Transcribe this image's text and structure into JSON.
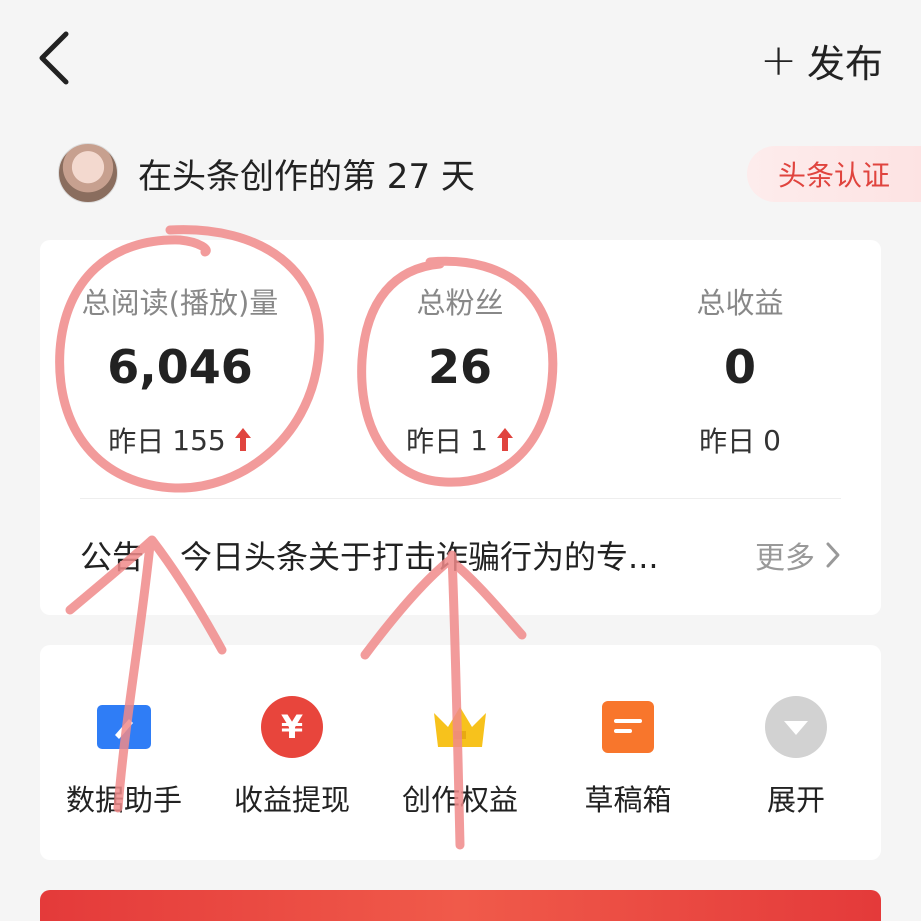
{
  "header": {
    "back_icon": "chevron-left-icon",
    "publish_plus": "+",
    "publish_label": "发布"
  },
  "creator": {
    "days_text": "在头条创作的第 27 天",
    "certification_label": "头条认证"
  },
  "stats": [
    {
      "label": "总阅读(播放)量",
      "value": "6,046",
      "yesterday_label": "昨日",
      "yesterday_value": "155",
      "trend": "up"
    },
    {
      "label": "总粉丝",
      "value": "26",
      "yesterday_label": "昨日",
      "yesterday_value": "1",
      "trend": "up"
    },
    {
      "label": "总收益",
      "value": "0",
      "yesterday_label": "昨日",
      "yesterday_value": "0",
      "trend": "none"
    }
  ],
  "notice": {
    "label": "公告",
    "text": "今日头条关于打击诈骗行为的专...",
    "more_label": "更多"
  },
  "tools": [
    {
      "label": "数据助手",
      "icon": "chart-pencil-icon",
      "color": "#2f7df6"
    },
    {
      "label": "收益提现",
      "icon": "yuan-icon",
      "color": "#e8453c"
    },
    {
      "label": "创作权益",
      "icon": "crown-icon",
      "color": "#f7c21c"
    },
    {
      "label": "草稿箱",
      "icon": "draft-icon",
      "color": "#f8762c"
    },
    {
      "label": "展开",
      "icon": "expand-icon",
      "color": "#cfcfcf"
    }
  ],
  "colors": {
    "accent_red": "#e0443e",
    "annotation_pink": "#f08a8a"
  }
}
